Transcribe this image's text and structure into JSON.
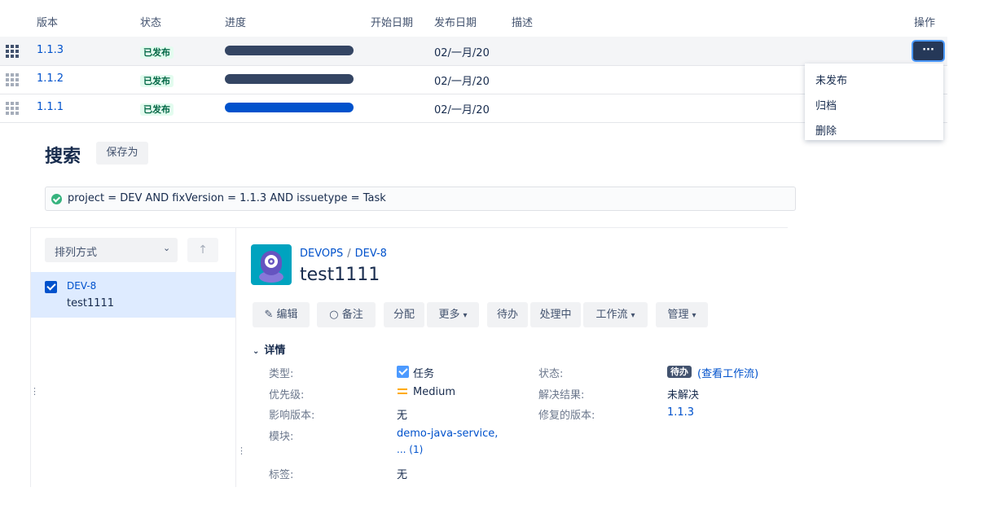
{
  "versions_table": {
    "headers": {
      "version": "版本",
      "status": "状态",
      "progress": "进度",
      "start_date": "开始日期",
      "release_date": "发布日期",
      "description": "描述",
      "actions": "操作"
    },
    "rows": [
      {
        "version": "1.1.3",
        "status": "已发布",
        "release_date": "02/一月/20",
        "progress_color": "#344563"
      },
      {
        "version": "1.1.2",
        "status": "已发布",
        "release_date": "02/一月/20",
        "progress_color": "#344563"
      },
      {
        "version": "1.1.1",
        "status": "已发布",
        "release_date": "02/一月/20",
        "progress_color": "#0052cc"
      }
    ],
    "more_button": "···",
    "action_menu": [
      "未发布",
      "归档",
      "删除"
    ]
  },
  "search": {
    "title": "搜索",
    "save_as": "保存为",
    "jql": "project = DEV AND fixVersion = 1.1.3  AND issuetype = Task",
    "sort_by": "排列方式",
    "sort_direction_icon": "↑",
    "results": [
      {
        "key": "DEV-8",
        "summary": "test1111",
        "checked": true
      }
    ]
  },
  "issue": {
    "breadcrumb": {
      "project": "DEVOPS",
      "key": "DEV-8"
    },
    "title": "test1111",
    "toolbar": {
      "edit": "编辑",
      "comment": "备注",
      "assign": "分配",
      "more": "更多",
      "todo": "待办",
      "in_progress": "处理中",
      "workflow": "工作流",
      "admin": "管理"
    },
    "details_heading": "详情",
    "fields": {
      "type_label": "类型:",
      "type_value": "任务",
      "status_label": "状态:",
      "status_value": "待办",
      "view_workflow": "(查看工作流)",
      "priority_label": "优先级:",
      "priority_value": "Medium",
      "resolution_label": "解决结果:",
      "resolution_value": "未解决",
      "affects_label": "影响版本:",
      "affects_value": "无",
      "fix_label": "修复的版本:",
      "fix_value": "1.1.3",
      "component_label": "模块:",
      "component_value": "demo-java-service,",
      "component_more": "... (1)",
      "labels_label": "标签:",
      "labels_value": "无"
    }
  },
  "colors": {
    "link": "#0052cc",
    "released_bg": "#e3fcef",
    "released_text": "#006644",
    "selected_row": "#deebff"
  }
}
